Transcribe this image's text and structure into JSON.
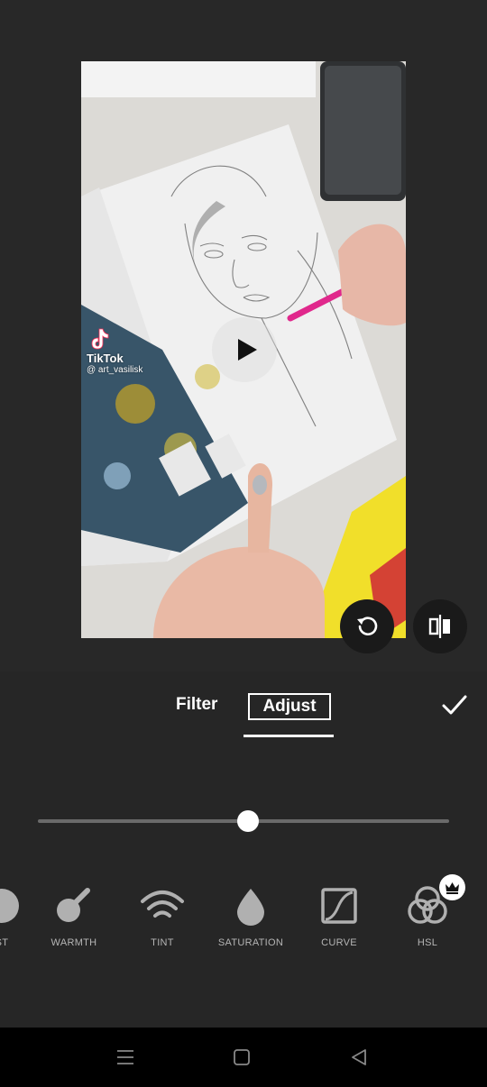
{
  "video": {
    "watermark_brand": "TikTok",
    "watermark_handle": "@ art_vasilisk"
  },
  "controls": {
    "play_icon": "play-icon",
    "rotate_icon": "rotate-icon",
    "mirror_icon": "mirror-icon"
  },
  "tabs": [
    {
      "label": "Filter",
      "selected": false
    },
    {
      "label": "Adjust",
      "selected": true
    }
  ],
  "confirm_icon": "checkmark-icon",
  "slider": {
    "value": 0.51
  },
  "tools": [
    {
      "label": "ST",
      "icon": "contrast-icon"
    },
    {
      "label": "WARMTH",
      "icon": "warmth-icon"
    },
    {
      "label": "TINT",
      "icon": "tint-icon"
    },
    {
      "label": "SATURATION",
      "icon": "saturation-icon"
    },
    {
      "label": "CURVE",
      "icon": "curve-icon"
    },
    {
      "label": "HSL",
      "icon": "hsl-icon",
      "premium": true
    }
  ],
  "nav": [
    "menu-icon",
    "home-icon",
    "back-icon"
  ],
  "colors": {
    "background": "#262626",
    "accent": "#ffffff",
    "icon": "#b0b0b0"
  }
}
